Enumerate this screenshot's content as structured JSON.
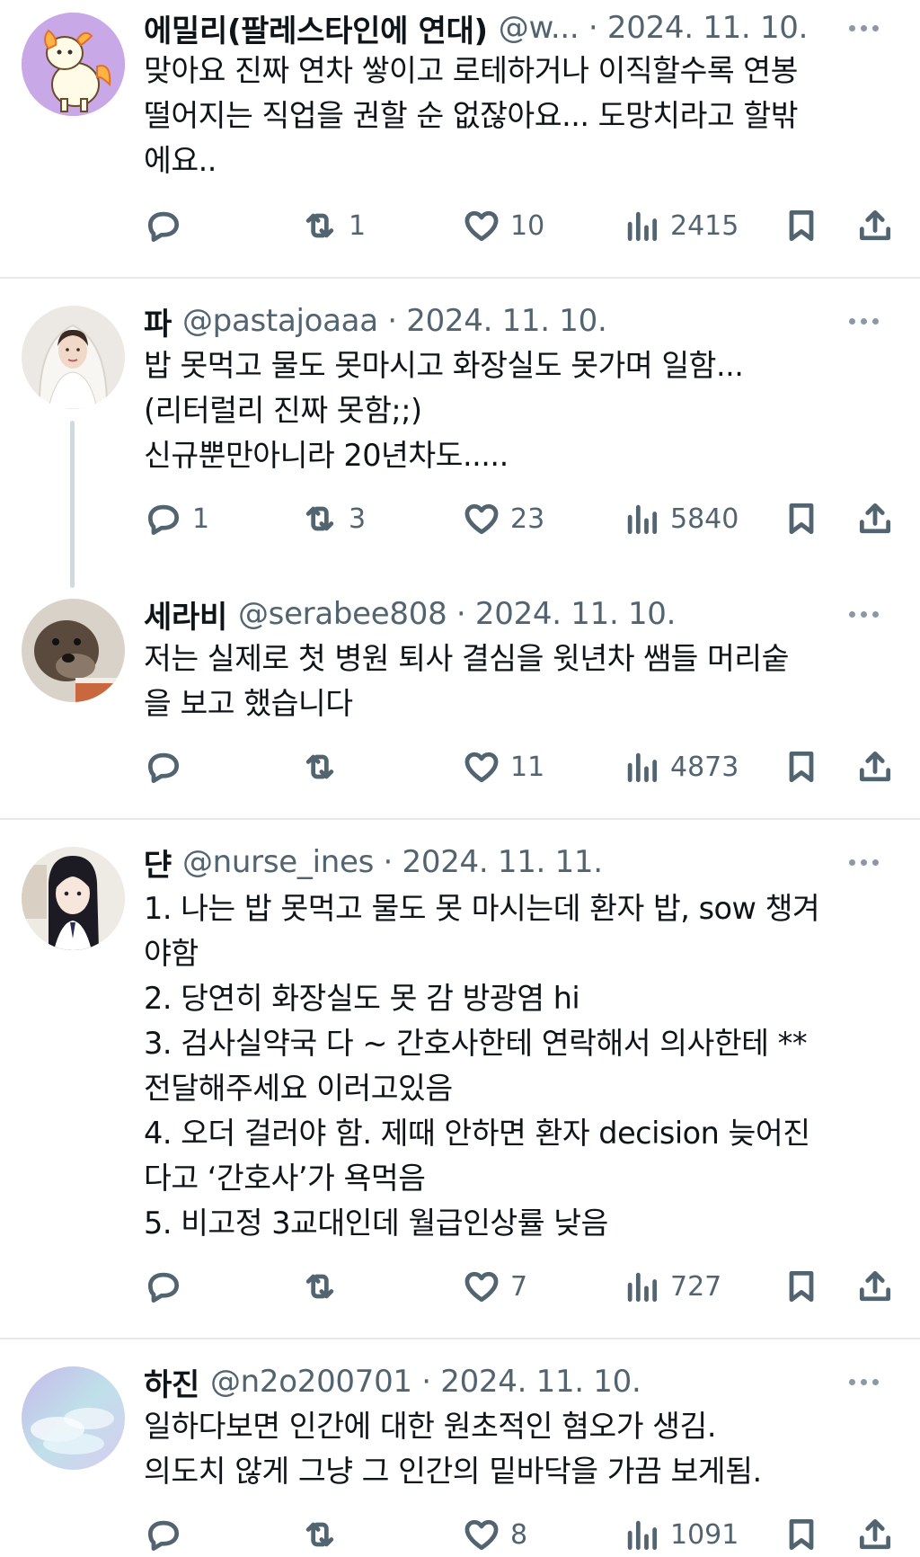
{
  "tweets": [
    {
      "name": "에밀리(팔레스타인에 연대)",
      "handle": "@w... · 2024. 11. 10.",
      "lines": [
        "맞아요 진짜 연차 쌓이고 로테하거나 이직할수록 연봉",
        "떨어지는 직업을 권할 순 없잖아요... 도망치라고 할밖",
        "에요.."
      ],
      "replies": "",
      "retweets": "1",
      "likes": "10",
      "views": "2415",
      "avatar_icon": "alpaca-avatar"
    },
    {
      "name": "파",
      "handle": "@pastajoaaa · 2024. 11. 10.",
      "lines": [
        "밥 못먹고 물도 못마시고 화장실도 못가며 일함...",
        "(리터럴리 진짜 못함;;)",
        "신규뿐만아니라 20년차도....."
      ],
      "replies": "1",
      "retweets": "3",
      "likes": "23",
      "views": "5840",
      "avatar_icon": "bride-avatar"
    },
    {
      "name": "세라비",
      "handle": "@serabee808 · 2024. 11. 10.",
      "lines": [
        "저는 실제로 첫 병원 퇴사 결심을 윗년차 쌤들 머리숱",
        "을 보고 했습니다"
      ],
      "replies": "",
      "retweets": "",
      "likes": "11",
      "views": "4873",
      "avatar_icon": "otter-avatar"
    },
    {
      "name": "댠",
      "handle": "@nurse_ines · 2024. 11. 11.",
      "lines": [
        "1. 나는 밥 못먹고 물도 못 마시는데 환자 밥, sow 챙겨",
        "야함",
        "2. 당연히 화장실도 못 감 방광염 hi",
        "3. 검사실약국 다 ~ 간호사한테 연락해서 의사한테 **",
        "전달해주세요 이러고있음",
        "4. 오더 걸러야 함. 제때 안하면 환자 decision 늦어진",
        "다고 ‘간호사’가 욕먹음",
        "5. 비고정 3교대인데 월급인상률 낮음"
      ],
      "replies": "",
      "retweets": "",
      "likes": "7",
      "views": "727",
      "avatar_icon": "anime-girl-avatar"
    },
    {
      "name": "하진",
      "handle": "@n2o200701 · 2024. 11. 10.",
      "lines": [
        "일하다보면 인간에 대한 원초적인 혐오가 생김.",
        "의도치 않게 그냥 그 인간의 밑바닥을 가끔 보게됨."
      ],
      "replies": "",
      "retweets": "",
      "likes": "8",
      "views": "1091",
      "avatar_icon": "sky-avatar"
    }
  ]
}
